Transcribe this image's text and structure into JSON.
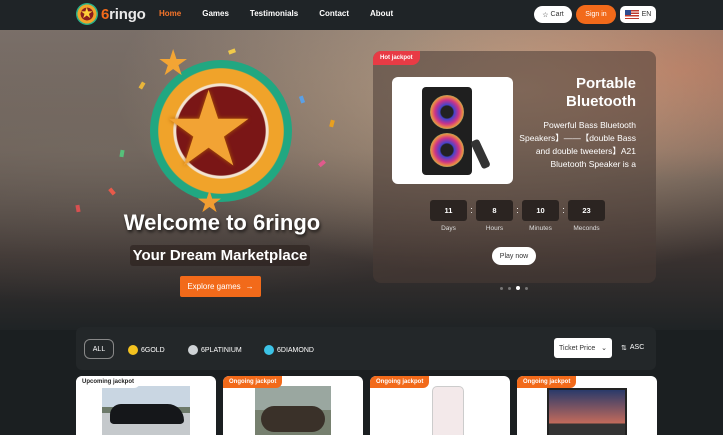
{
  "nav": {
    "brand_prefix": "6",
    "brand_rest": "ringo",
    "links": [
      "Home",
      "Games",
      "Testimonials",
      "Contact",
      "About"
    ],
    "cart_label": "Cart",
    "signin_label": "Sign in",
    "lang_label": "EN"
  },
  "hero": {
    "welcome": "Welcome to 6ringo",
    "tagline": "Your Dream Marketplace",
    "explore_label": "Explore games",
    "explore_icon": "→"
  },
  "jackpot": {
    "tag": "Hot jackpot",
    "title": "Portable Bluetooth",
    "description": "Powerful Bass Bluetooth Speakers】——【double Bass and double tweeters】A21 Bluetooth Speaker is a",
    "countdown": [
      {
        "value": "11",
        "label": "Days"
      },
      {
        "value": "8",
        "label": "Hours"
      },
      {
        "value": "10",
        "label": "Minutes"
      },
      {
        "value": "23",
        "label": "Meconds"
      }
    ],
    "play_label": "Play now"
  },
  "filter": {
    "all_label": "ALL",
    "tiers": [
      {
        "label": "6GOLD",
        "color": "#f4c21f"
      },
      {
        "label": "6PLATINIUM",
        "color": "#cfd3d6"
      },
      {
        "label": "6DIAMOND",
        "color": "#3cc3e6"
      }
    ],
    "sort_select": "Ticket Price",
    "sort_order": "ASC"
  },
  "cards": [
    {
      "tag": "Upcoming jackpot",
      "tag_style": "upcoming"
    },
    {
      "tag": "Ongoing jackpot",
      "tag_style": "ongoing"
    },
    {
      "tag": "Ongoing jackpot",
      "tag_style": "ongoing"
    },
    {
      "tag": "Ongoing jackpot",
      "tag_style": "ongoing"
    }
  ],
  "colors": {
    "accent": "#f26a1a",
    "hot": "#e83b45"
  }
}
